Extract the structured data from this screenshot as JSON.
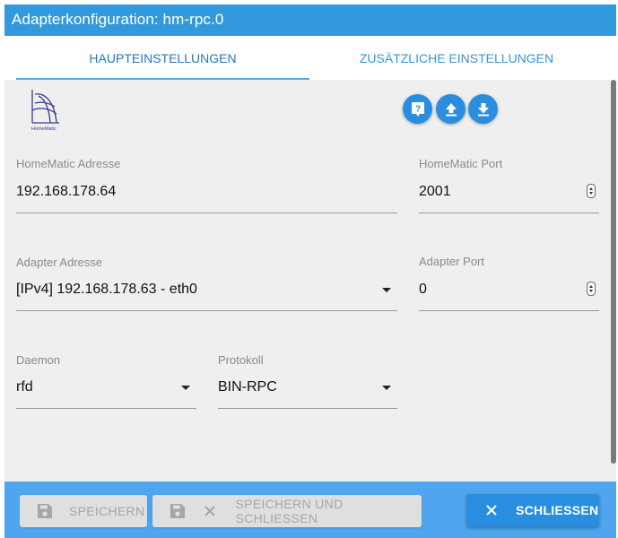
{
  "dialog": {
    "title": "Adapterkonfiguration: hm-rpc.0"
  },
  "tabs": [
    {
      "label": "HAUPTEINSTELLUNGEN",
      "active": true
    },
    {
      "label": "ZUSÄTZLICHE EINSTELLUNGEN",
      "active": false
    }
  ],
  "logo": {
    "text": "HomeMatic"
  },
  "actions": {
    "help_icon": "help-icon",
    "upload_icon": "upload-icon",
    "download_icon": "download-icon"
  },
  "form": {
    "homematic_address": {
      "label": "HomeMatic Adresse",
      "value": "192.168.178.64"
    },
    "homematic_port": {
      "label": "HomeMatic Port",
      "value": "2001"
    },
    "adapter_address": {
      "label": "Adapter Adresse",
      "value": "[IPv4] 192.168.178.63 - eth0"
    },
    "adapter_port": {
      "label": "Adapter Port",
      "value": "0"
    },
    "daemon": {
      "label": "Daemon",
      "value": "rfd"
    },
    "protocol": {
      "label": "Protokoll",
      "value": "BIN-RPC"
    }
  },
  "footer": {
    "save_label": "SPEICHERN",
    "save_close_label": "SPEICHERN UND SCHLIESSEN",
    "close_label": "SCHLIESSEN"
  },
  "colors": {
    "primary": "#2a8ee0",
    "titlebar": "#3399dd",
    "footer": "#4fa6ee",
    "content_bg": "#efefef"
  }
}
